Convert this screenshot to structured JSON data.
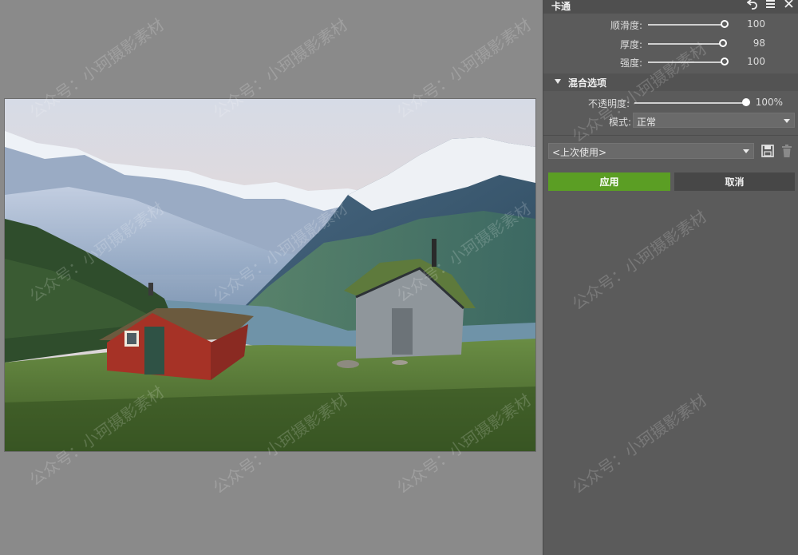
{
  "panel": {
    "title": "卡通",
    "icons": [
      "undo-icon",
      "menu-icon",
      "close-icon"
    ]
  },
  "sliders": [
    {
      "label": "顺滑度:",
      "value": "100",
      "fraction": 1.0
    },
    {
      "label": "厚度:",
      "value": "98",
      "fraction": 0.98
    },
    {
      "label": "强度:",
      "value": "100",
      "fraction": 1.0
    }
  ],
  "blend": {
    "section_title": "混合选项",
    "opacity_label": "不透明度:",
    "opacity_value": "100%",
    "opacity_fraction": 1.0,
    "mode_label": "模式:",
    "mode_value": "正常"
  },
  "preset": {
    "value": "<上次使用>",
    "icons": [
      "save-icon",
      "trash-icon"
    ]
  },
  "actions": {
    "apply_label": "应用",
    "cancel_label": "取消"
  },
  "colors": {
    "apply": "#5b9e24",
    "panel": "#5b5b5b",
    "canvas": "#8a8a8a"
  },
  "watermark": "公众号：小珂摄影素材"
}
